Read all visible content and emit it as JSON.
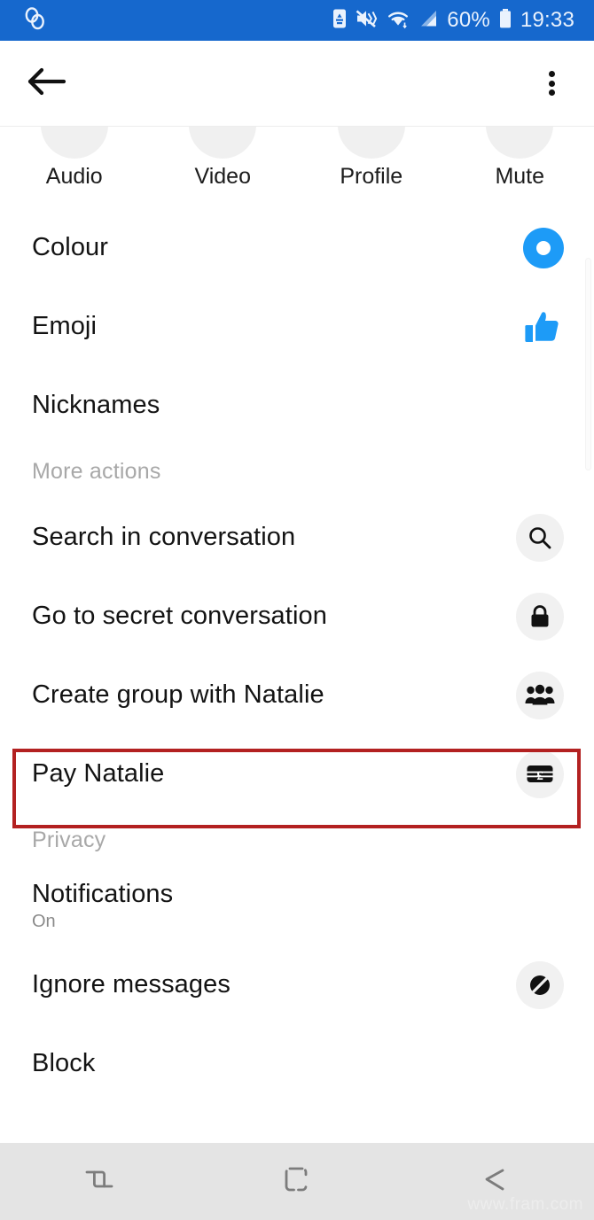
{
  "status_bar": {
    "time": "19:33",
    "battery_percent": "60%",
    "icons": [
      "sim-recycle-icon",
      "mute-vibrate-icon",
      "wifi-icon",
      "cellular-signal-icon",
      "battery-icon"
    ],
    "background_color": "#1668cd",
    "text_color": "#eaf2fd",
    "left_icon": "chain-link-icon"
  },
  "app_bar": {
    "back_label": "back-arrow",
    "overflow_label": "more-options"
  },
  "quick_actions": [
    {
      "label": "Audio",
      "icon": "phone-icon"
    },
    {
      "label": "Video",
      "icon": "video-camera-icon"
    },
    {
      "label": "Profile",
      "icon": "person-icon"
    },
    {
      "label": "Mute",
      "icon": "bell-mute-icon"
    }
  ],
  "sections": [
    {
      "header": null,
      "rows": [
        {
          "label": "Colour",
          "sub": null,
          "trail": "colour-donut",
          "chip": false
        },
        {
          "label": "Emoji",
          "sub": null,
          "trail": "thumbs-up-icon",
          "chip": false
        },
        {
          "label": "Nicknames",
          "sub": null,
          "trail": null,
          "chip": false
        }
      ]
    },
    {
      "header": "More actions",
      "rows": [
        {
          "label": "Search in conversation",
          "sub": null,
          "trail": "search-icon",
          "chip": true
        },
        {
          "label": "Go to secret conversation",
          "sub": null,
          "trail": "lock-icon",
          "chip": true
        },
        {
          "label": "Create group with Natalie",
          "sub": null,
          "trail": "group-people-icon",
          "chip": true
        },
        {
          "label": "Pay Natalie",
          "sub": null,
          "trail": "banknote-pound-icon",
          "chip": true,
          "highlighted": true
        }
      ]
    },
    {
      "header": "Privacy",
      "rows": [
        {
          "label": "Notifications",
          "sub": "On",
          "trail": null,
          "chip": false
        },
        {
          "label": "Ignore messages",
          "sub": null,
          "trail": "ignore-slash-icon",
          "chip": true
        },
        {
          "label": "Block",
          "sub": null,
          "trail": null,
          "chip": false
        }
      ]
    }
  ],
  "highlight": {
    "target_row": "Pay Natalie",
    "color": "#b32121"
  },
  "nav_bar": {
    "buttons": [
      {
        "name": "recents",
        "icon": "recents-icon"
      },
      {
        "name": "home",
        "icon": "home-square-icon"
      },
      {
        "name": "back",
        "icon": "back-chevron-icon"
      }
    ],
    "background_color": "#e4e4e4"
  },
  "watermark": {
    "text": "www.fram.com"
  },
  "theme": {
    "accent_blue": "#1d9bf7",
    "chip_grey": "#f1f1f1",
    "text_primary": "#131313",
    "text_muted": "#a8a8a8"
  }
}
